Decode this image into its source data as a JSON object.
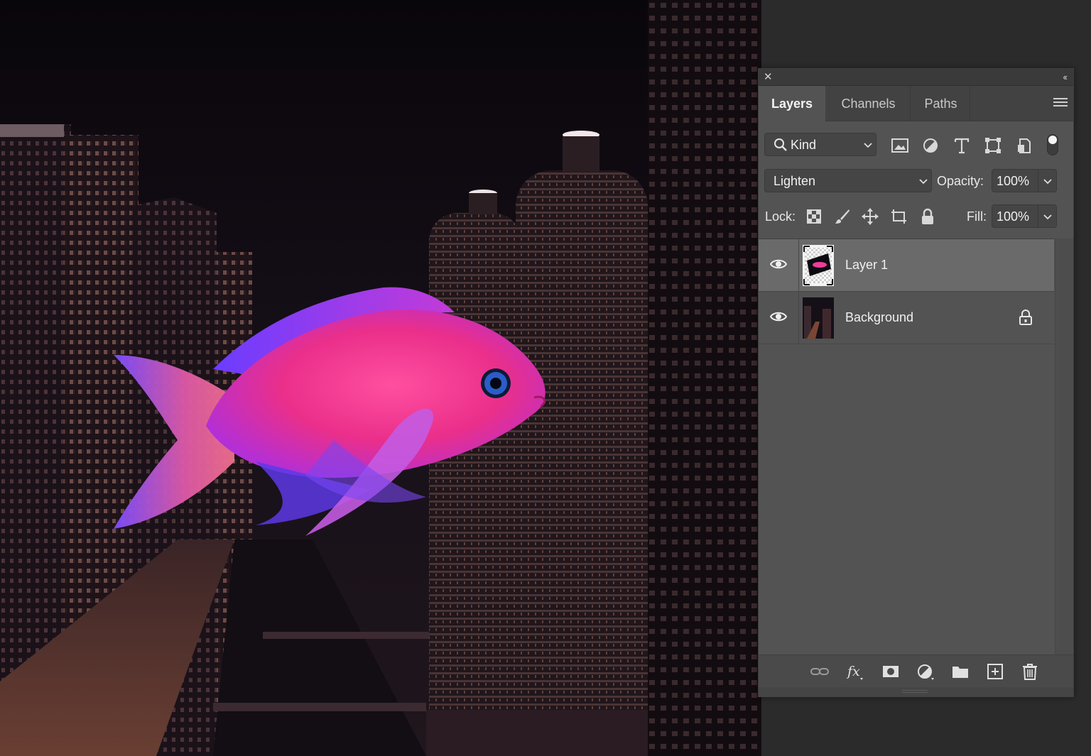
{
  "panel": {
    "close_glyph": "✕",
    "collapse_glyph": "‹‹",
    "tabs": [
      {
        "label": "Layers",
        "active": true
      },
      {
        "label": "Channels",
        "active": false
      },
      {
        "label": "Paths",
        "active": false
      }
    ],
    "menu_icon": "hamburger-menu-icon"
  },
  "filter": {
    "kind_label": "Kind",
    "icons": [
      "image-filter-icon",
      "adjustment-filter-icon",
      "type-filter-icon",
      "shape-filter-icon",
      "smart-object-filter-icon"
    ],
    "toggle_on": true
  },
  "blend": {
    "mode": "Lighten",
    "opacity_label": "Opacity:",
    "opacity_value": "100%"
  },
  "lock": {
    "label": "Lock:",
    "icons": [
      "lock-transparent-pixels-icon",
      "lock-image-pixels-icon",
      "lock-position-icon",
      "lock-artboard-icon",
      "lock-all-icon"
    ],
    "fill_label": "Fill:",
    "fill_value": "100%"
  },
  "layers": [
    {
      "name": "Layer 1",
      "visible": true,
      "selected": true,
      "locked": false
    },
    {
      "name": "Background",
      "visible": true,
      "selected": false,
      "locked": true
    }
  ],
  "bottom_bar": {
    "icons": [
      "link-layers-icon",
      "layer-style-fx-icon",
      "add-mask-icon",
      "adjustment-layer-icon",
      "new-group-folder-icon",
      "new-layer-icon",
      "delete-layer-icon"
    ]
  },
  "colors": {
    "panel_bg": "#535353",
    "selected_row": "#6a6a6a",
    "fish_pink": "#f0358e",
    "fish_purple": "#7b3cff"
  }
}
